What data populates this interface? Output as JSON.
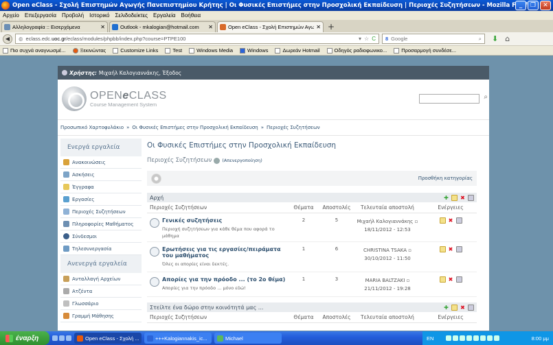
{
  "window": {
    "title": "Open eClass - Σχολή Επιστημών Αγωγής Πανεπιστημίου Κρήτης | Οι Φυσικές Επιστήμες στην Προσχολική Εκπαίδευση | Περιοχές Συζητήσεων - Mozilla Firefox"
  },
  "menu": [
    "Αρχείο",
    "Επεξεργασία",
    "Προβολή",
    "Ιστορικό",
    "Σελιδοδείκτες",
    "Εργαλεία",
    "Βοήθεια"
  ],
  "tabs": [
    {
      "label": "Αλληλογραφία :: Εισερχόμενα",
      "icon_color": "#6c8fb5",
      "active": false
    },
    {
      "label": "Outlook - mkalogian@hotmail.com",
      "icon_color": "#1f6fd1",
      "active": false
    },
    {
      "label": "Open eClass - Σχολή Επιστημών Αγωγής ...",
      "icon_color": "#d86a2a",
      "active": true
    }
  ],
  "nav": {
    "url_prefix": "eclass.edc.",
    "url_host": "uoc.gr",
    "url_path": "/eclass/modules/phpbb/index.php?course=PTPE100",
    "search_placeholder": "Google",
    "search_engine": "8"
  },
  "bookmarks": [
    "Πιο συχνά αναγνωσμέ...",
    "Ξεκινώντας",
    "Customize Links",
    "Test",
    "Windows Media",
    "Windows",
    "Δωρεάν Hotmail",
    "Οδηγός ραδιοφωνικο...",
    "Προσαρμογή συνδέσε..."
  ],
  "site": {
    "user_label": "Χρήστης:",
    "user_name": "Μιχαήλ Καλογιαννάκης, Έξοδος",
    "logo_open": "OPEN",
    "logo_e": "e",
    "logo_class": "CLASS",
    "logo_sub": "Course Management System",
    "breadcrumb": [
      "Προσωπικό Χαρτοφυλάκιο",
      "»",
      "Οι Φυσικές Επιστήμες στην Προσχολική Εκπαίδευση",
      "»",
      "Περιοχές Συζητήσεων"
    ],
    "sidebar_active_title": "Ενεργά εργαλεία",
    "sidebar_active": [
      {
        "label": "Ανακοινώσεις",
        "color": "#d9a23a"
      },
      {
        "label": "Ασκήσεις",
        "color": "#7da4c7"
      },
      {
        "label": "Έγγραφα",
        "color": "#e7c85a"
      },
      {
        "label": "Εργασίες",
        "color": "#5aa0d0"
      },
      {
        "label": "Περιοχές Συζητήσεων",
        "color": "#8fb2d6"
      },
      {
        "label": "Πληροφορίες Μαθήματος",
        "color": "#6d8fb2"
      },
      {
        "label": "Σύνδεσμοι",
        "color": "#3c5f8a"
      },
      {
        "label": "Τηλεσυνεργασία",
        "color": "#6e9bc4"
      }
    ],
    "sidebar_inactive_title": "Ανενεργά εργαλεία",
    "sidebar_inactive": [
      {
        "label": "Ανταλλαγή Αρχείων",
        "color": "#c8a05a"
      },
      {
        "label": "Ατζέντα",
        "color": "#aaaaaa"
      },
      {
        "label": "Γλωσσάριο",
        "color": "#bfbfbf"
      },
      {
        "label": "Γραμμή Μάθησης",
        "color": "#d78b3a"
      }
    ],
    "page_title": "Οι Φυσικές Επιστήμες στην Προσχολική Εκπαίδευση",
    "section_title": "Περιοχές Συζητήσεων",
    "section_toggle": "(Απενεργοποίηση)",
    "add_category": "Προσθήκη κατηγορίας",
    "columns": [
      "Περιοχές Συζητήσεων",
      "Θέματα",
      "Αποστολές",
      "Τελευταία αποστολή",
      "Ενέργειες"
    ],
    "categories": [
      {
        "name": "Αρχή",
        "forums": [
          {
            "title": "Γενικές συζητήσεις",
            "desc": "Περιοχή συζητήσεων για κάθε θέμα που αφορά το μάθημα",
            "topics": "2",
            "posts": "5",
            "last_user": "Μιχαήλ Καλογιαννάκης",
            "last_date": "18/11/2012 - 12:53"
          },
          {
            "title": "Ερωτήσεις για τις εργασίες/πειράματα του μαθήματος",
            "desc": "Όλες οι απορίες είναι δεκτές.",
            "topics": "1",
            "posts": "6",
            "last_user": "CHRISTINA TSAKA",
            "last_date": "30/10/2012 - 11:50"
          },
          {
            "title": "Απορίες για την πρόοδο ... (το 2ο θέμα)",
            "desc": "Απορίες για την πρόοδο ... μόνο εδώ!",
            "topics": "1",
            "posts": "3",
            "last_user": "MARIA BALTZAKI",
            "last_date": "21/11/2012 - 19:28"
          }
        ]
      },
      {
        "name": "Στείλτε ένα δώρο στην κοινότητά μας ...",
        "forums": []
      }
    ]
  },
  "taskbar": {
    "start": "έναρξη",
    "tasks": [
      "Open eClass - Σχολή ...",
      "+++Kalogiannakis_ic...",
      "Michael"
    ],
    "lang": "EN",
    "clock": "8:00 μμ"
  }
}
